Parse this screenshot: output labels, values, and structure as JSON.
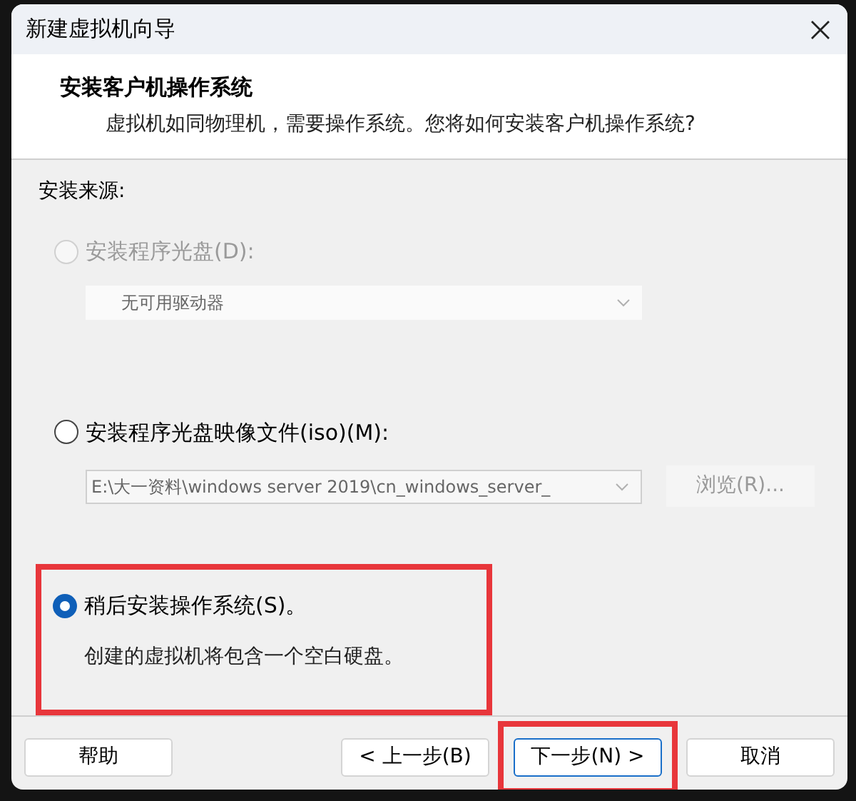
{
  "window": {
    "title": "新建虚拟机向导"
  },
  "header": {
    "title": "安装客户机操作系统",
    "subtitle": "虚拟机如同物理机，需要操作系统。您将如何安装客户机操作系统?"
  },
  "source_label": "安装来源:",
  "options": [
    {
      "kind": "drive",
      "label": "安装程序光盘(D):",
      "selected": false,
      "disabled": true,
      "highlighted": false,
      "dropdown": {
        "value": "无可用驱动器",
        "disabled": true
      }
    },
    {
      "kind": "iso",
      "label": "安装程序光盘映像文件(iso)(M):",
      "selected": false,
      "disabled": false,
      "highlighted": false,
      "dropdown": {
        "value": "E:\\大一资料\\windows server 2019\\cn_windows_server_",
        "disabled": true
      },
      "browse": {
        "label": "浏览(R)...",
        "disabled": true
      }
    },
    {
      "kind": "later",
      "label": "稍后安装操作系统(S)。",
      "selected": true,
      "disabled": false,
      "highlighted": true,
      "description": "创建的虚拟机将包含一个空白硬盘。"
    }
  ],
  "buttons": [
    {
      "label": "帮助",
      "focused": false,
      "highlighted": false
    },
    {
      "label": "< 上一步(B)",
      "focused": false,
      "highlighted": false
    },
    {
      "label": "下一步(N) >",
      "focused": true,
      "highlighted": true
    },
    {
      "label": "取消",
      "focused": false,
      "highlighted": false
    }
  ]
}
